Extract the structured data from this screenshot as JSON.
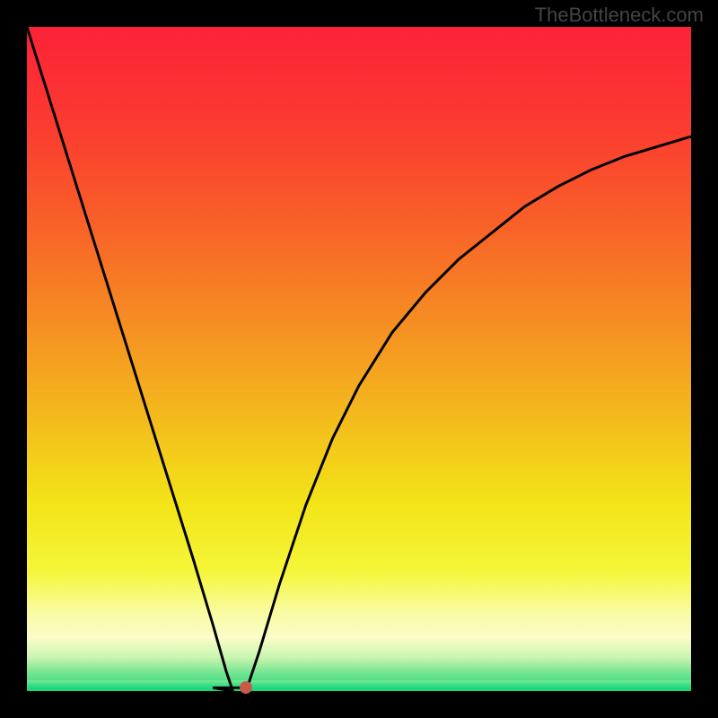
{
  "watermark": "TheBottleneck.com",
  "chart_data": {
    "type": "line",
    "title": "",
    "xlabel": "",
    "ylabel": "",
    "xlim": [
      0,
      100
    ],
    "ylim": [
      0,
      100
    ],
    "vertex_x": 31,
    "vertex_y": 0,
    "marker": {
      "x": 33,
      "y": 0.5,
      "color": "#c85a4a"
    },
    "curve_points_left": [
      {
        "x": 0,
        "y": 100
      },
      {
        "x": 5,
        "y": 84
      },
      {
        "x": 10,
        "y": 68
      },
      {
        "x": 15,
        "y": 52
      },
      {
        "x": 20,
        "y": 36
      },
      {
        "x": 25,
        "y": 20
      },
      {
        "x": 28,
        "y": 10
      },
      {
        "x": 30,
        "y": 3
      },
      {
        "x": 31,
        "y": 0
      }
    ],
    "plateau": [
      {
        "x": 28,
        "y": 0.5
      },
      {
        "x": 33,
        "y": 0.5
      }
    ],
    "curve_points_right": [
      {
        "x": 33,
        "y": 0
      },
      {
        "x": 35,
        "y": 6
      },
      {
        "x": 38,
        "y": 16
      },
      {
        "x": 42,
        "y": 28
      },
      {
        "x": 46,
        "y": 38
      },
      {
        "x": 50,
        "y": 46
      },
      {
        "x": 55,
        "y": 54
      },
      {
        "x": 60,
        "y": 60
      },
      {
        "x": 65,
        "y": 65
      },
      {
        "x": 70,
        "y": 69
      },
      {
        "x": 75,
        "y": 73
      },
      {
        "x": 80,
        "y": 76
      },
      {
        "x": 85,
        "y": 78.5
      },
      {
        "x": 90,
        "y": 80.5
      },
      {
        "x": 95,
        "y": 82
      },
      {
        "x": 100,
        "y": 83.5
      }
    ],
    "gradient_stops": [
      {
        "offset": 0,
        "color": "#fc2238"
      },
      {
        "offset": 15,
        "color": "#fb3b30"
      },
      {
        "offset": 30,
        "color": "#f86228"
      },
      {
        "offset": 45,
        "color": "#f58f22"
      },
      {
        "offset": 60,
        "color": "#f3be1c"
      },
      {
        "offset": 72,
        "color": "#f3e518"
      },
      {
        "offset": 82,
        "color": "#f5f63a"
      },
      {
        "offset": 88,
        "color": "#f9fba0"
      },
      {
        "offset": 92,
        "color": "#fbfcc8"
      },
      {
        "offset": 95,
        "color": "#c8f5b0"
      },
      {
        "offset": 97,
        "color": "#7de693"
      },
      {
        "offset": 100,
        "color": "#1ed97a"
      }
    ]
  }
}
